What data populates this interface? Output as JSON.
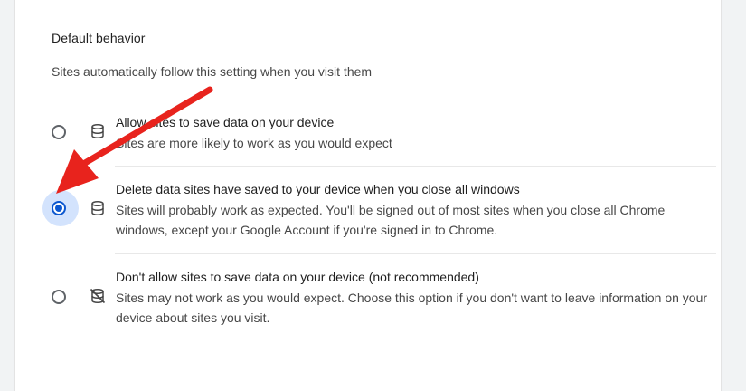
{
  "section": {
    "title": "Default behavior",
    "description": "Sites automatically follow this setting when you visit them"
  },
  "options": [
    {
      "label": "Allow sites to save data on your device",
      "sublabel": "Sites are more likely to work as you would expect",
      "icon": "database-icon",
      "selected": false
    },
    {
      "label": "Delete data sites have saved to your device when you close all windows",
      "sublabel": "Sites will probably work as expected. You'll be signed out of most sites when you close all Chrome windows, except your Google Account if you're signed in to Chrome.",
      "icon": "database-icon",
      "selected": true
    },
    {
      "label": "Don't allow sites to save data on your device (not recommended)",
      "sublabel": "Sites may not work as you would expect. Choose this option if you don't want to leave information on your device about sites you visit.",
      "icon": "database-off-icon",
      "selected": false
    }
  ],
  "colors": {
    "accent": "#0b57d0",
    "annotation_arrow": "#e8231d"
  }
}
